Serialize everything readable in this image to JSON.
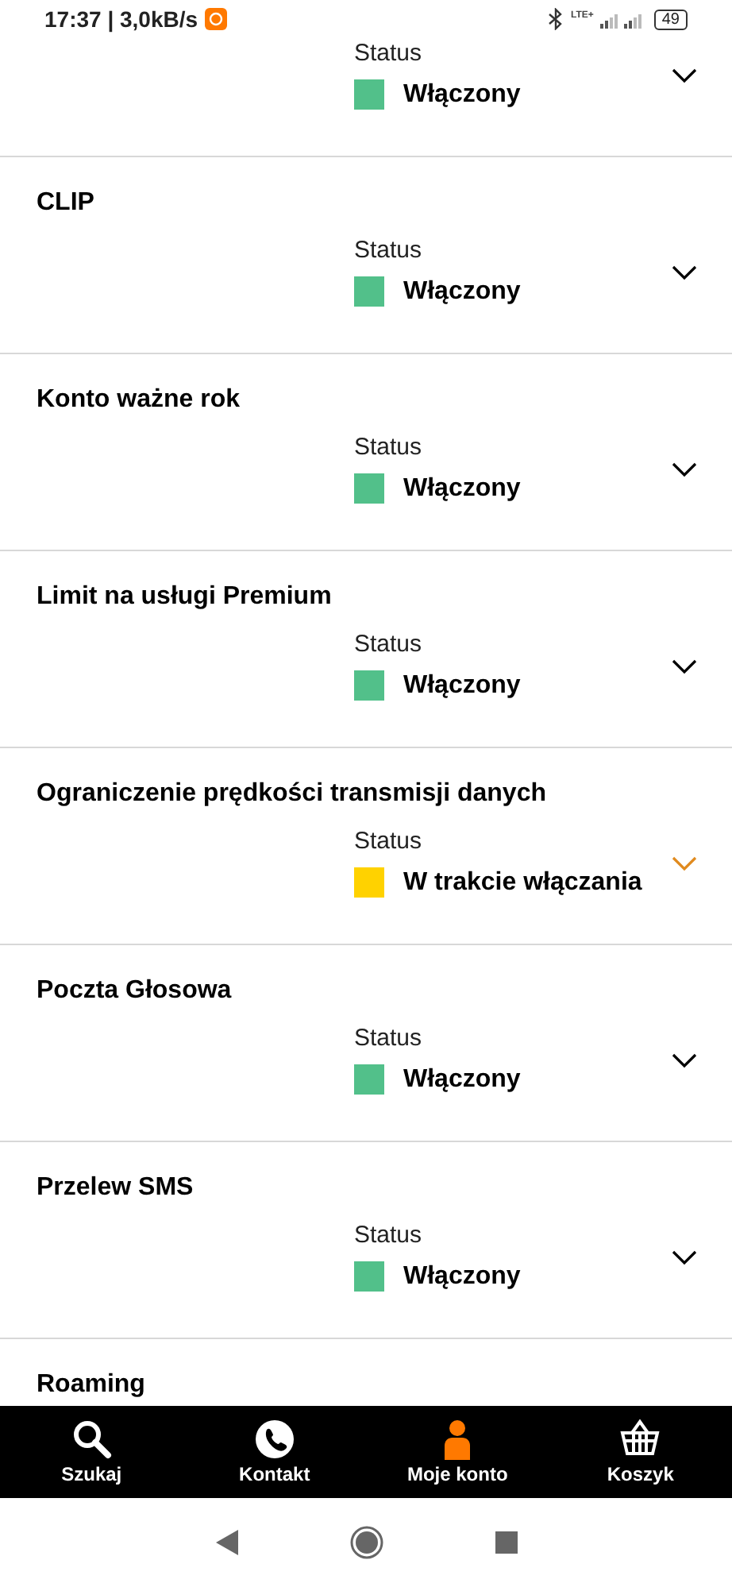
{
  "status_bar": {
    "time": "17:37 | 3,0kB/s",
    "network": "LTE+",
    "battery": "49"
  },
  "services": [
    {
      "status_label": "Status",
      "status": "Włączony",
      "kind": "active",
      "color": "#52c08a"
    },
    {
      "title": "CLIP",
      "status_label": "Status",
      "status": "Włączony",
      "kind": "active",
      "color": "#52c08a"
    },
    {
      "title": "Konto ważne rok",
      "status_label": "Status",
      "status": "Włączony",
      "kind": "active",
      "color": "#52c08a"
    },
    {
      "title": "Limit na usługi Premium",
      "status_label": "Status",
      "status": "Włączony",
      "kind": "active",
      "color": "#52c08a"
    },
    {
      "title": "Ograniczenie prędkości transmisji danych",
      "status_label": "Status",
      "status": "W trakcie włączania",
      "kind": "pending",
      "color": "#ffd200"
    },
    {
      "title": "Poczta Głosowa",
      "status_label": "Status",
      "status": "Włączony",
      "kind": "active",
      "color": "#52c08a"
    },
    {
      "title": "Przelew SMS",
      "status_label": "Status",
      "status": "Włączony",
      "kind": "active",
      "color": "#52c08a"
    },
    {
      "title": "Roaming"
    }
  ],
  "bottom_nav": [
    {
      "label": "Szukaj",
      "kind": "search",
      "selected": false
    },
    {
      "label": "Kontakt",
      "kind": "phone",
      "selected": false
    },
    {
      "label": "Moje konto",
      "kind": "person",
      "selected": true
    },
    {
      "label": "Koszyk",
      "kind": "basket",
      "selected": false
    }
  ]
}
